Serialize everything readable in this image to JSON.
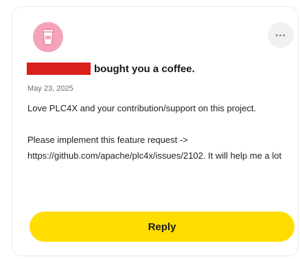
{
  "notification": {
    "headline": "bought you a coffee.",
    "date": "May 23, 2025",
    "message_para1": "Love PLC4X and your contribution/support on this project.",
    "message_para2": "Please implement this feature request -> https://github.com/apache/plc4x/issues/2102. It will help me a lot",
    "more_label": "···",
    "reply_label": "Reply"
  },
  "icons": {
    "avatar": "coffee-cup-icon",
    "more": "more-options-icon"
  },
  "colors": {
    "avatar_bg": "#f6a3b9",
    "reply_button": "#ffdd00",
    "redaction": "#d9201c",
    "more_button_bg": "#f1f1f1"
  }
}
